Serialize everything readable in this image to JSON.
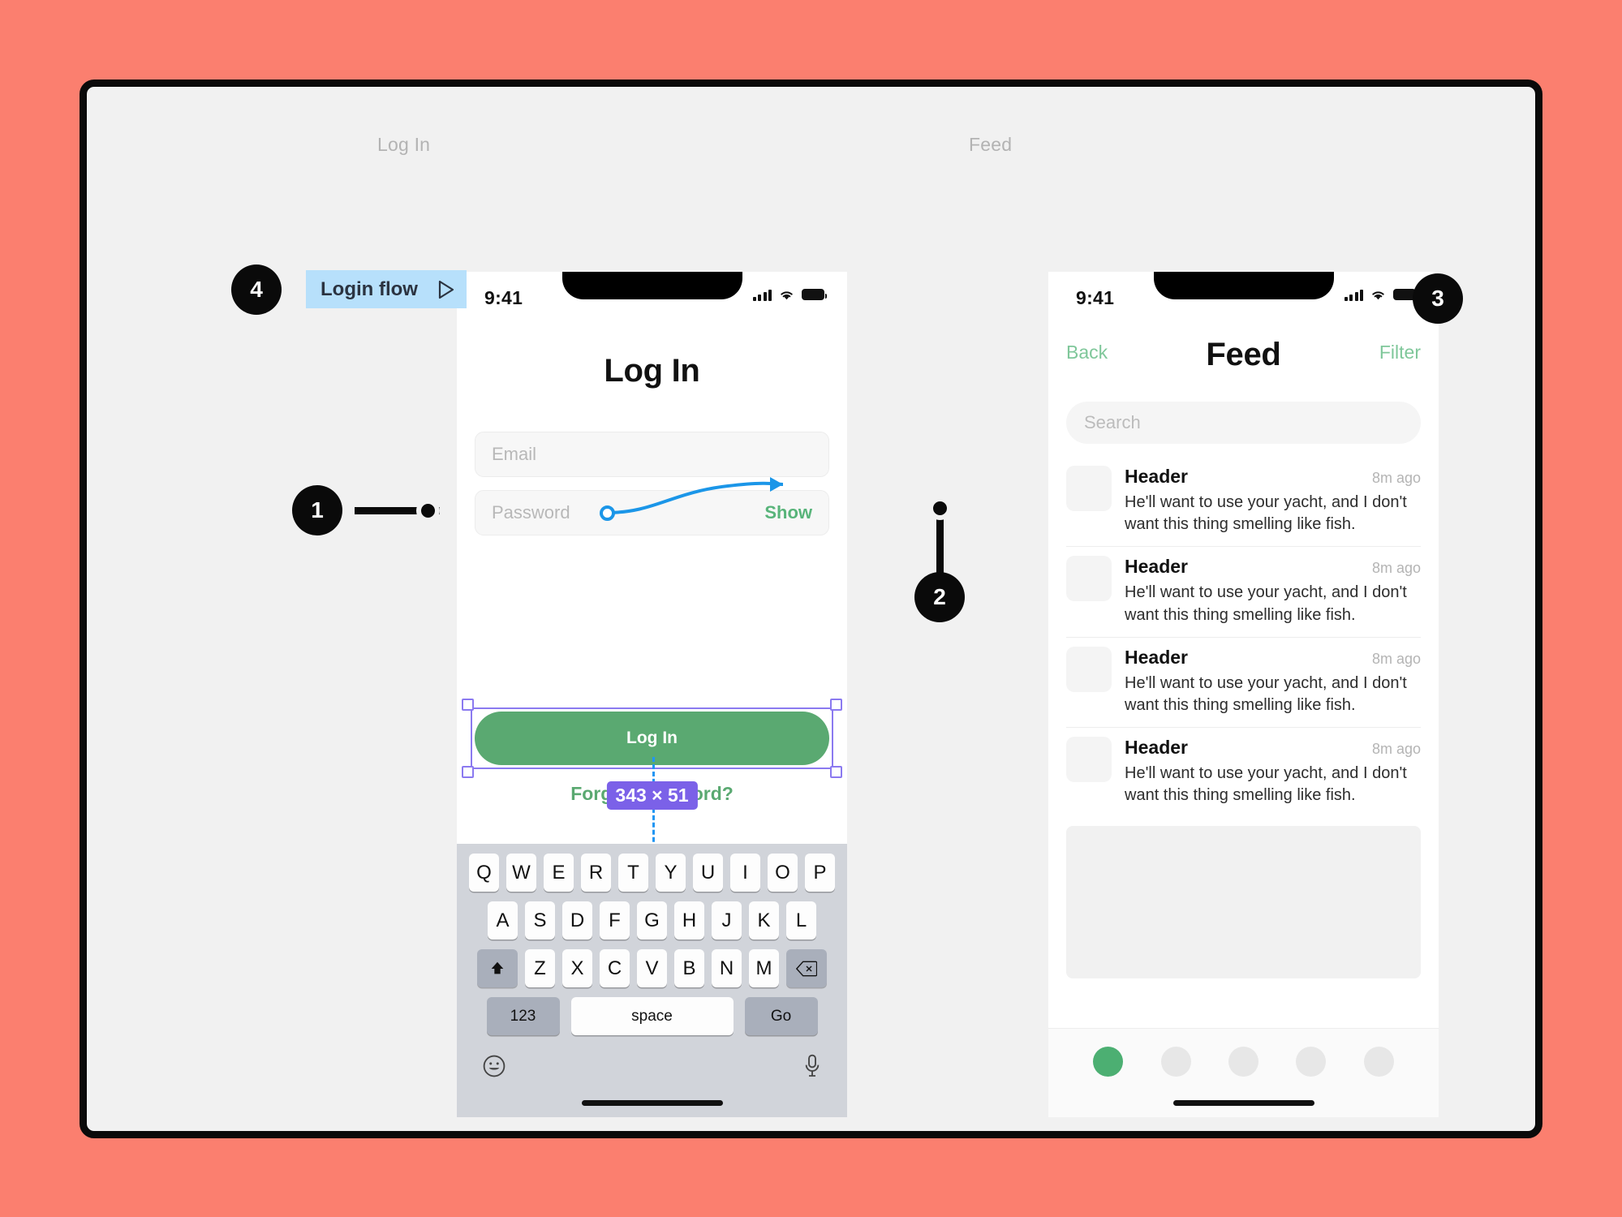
{
  "page": {
    "background_color": "#fb7f6f",
    "canvas_color": "#f1f1f1"
  },
  "frames": [
    {
      "label": "Log In"
    },
    {
      "label": "Feed"
    }
  ],
  "flow_chip": {
    "label": "Login flow",
    "icon": "play-triangle-icon",
    "color": "#b7e0fb"
  },
  "annotations": [
    {
      "number": "1"
    },
    {
      "number": "2"
    },
    {
      "number": "3"
    },
    {
      "number": "4"
    }
  ],
  "login_screen": {
    "status_bar": {
      "time": "9:41",
      "icons": [
        "cellular-signal-icon",
        "wifi-icon",
        "battery-icon"
      ]
    },
    "title": "Log In",
    "fields": [
      {
        "placeholder": "Email",
        "value": "",
        "action": ""
      },
      {
        "placeholder": "Password",
        "value": "",
        "action": "Show"
      }
    ],
    "primary_button": {
      "label": "Log In",
      "color": "#5aa971"
    },
    "forgot_link": "Forgot password?",
    "selection": {
      "size_badge": "343 × 51",
      "badge_color": "#7b61e8",
      "handle_color": "#8b7af0"
    },
    "keyboard": {
      "row1": [
        "Q",
        "W",
        "E",
        "R",
        "T",
        "Y",
        "U",
        "I",
        "O",
        "P"
      ],
      "row2": [
        "A",
        "S",
        "D",
        "F",
        "G",
        "H",
        "J",
        "K",
        "L"
      ],
      "row3_shift": "shift-icon",
      "row3": [
        "Z",
        "X",
        "C",
        "V",
        "B",
        "N",
        "M"
      ],
      "row3_backspace": "backspace-icon",
      "numbers_key": "123",
      "space_key": "space",
      "return_key": "Go",
      "emoji_key": "emoji-icon",
      "mic_key": "microphone-icon"
    }
  },
  "feed_screen": {
    "status_bar": {
      "time": "9:41",
      "icons": [
        "cellular-signal-icon",
        "wifi-icon",
        "battery-icon"
      ]
    },
    "nav": {
      "back": "Back",
      "title": "Feed",
      "filter": "Filter",
      "accent_color": "#7fc79a"
    },
    "search": {
      "placeholder": "Search"
    },
    "items": [
      {
        "header": "Header",
        "time": "8m ago",
        "text": "He'll want to use your yacht, and I don't want this thing smelling like fish."
      },
      {
        "header": "Header",
        "time": "8m ago",
        "text": "He'll want to use your yacht, and I don't want this thing smelling like fish."
      },
      {
        "header": "Header",
        "time": "8m ago",
        "text": "He'll want to use your yacht, and I don't want this thing smelling like fish."
      },
      {
        "header": "Header",
        "time": "8m ago",
        "text": "He'll want to use your yacht, and I don't want this thing smelling like fish."
      }
    ],
    "tabbar": {
      "dot_count": 5,
      "active_index": 0,
      "active_color": "#4caf72"
    }
  },
  "connector": {
    "color": "#1b96e8",
    "from": "login-button",
    "to": "feed-list"
  }
}
